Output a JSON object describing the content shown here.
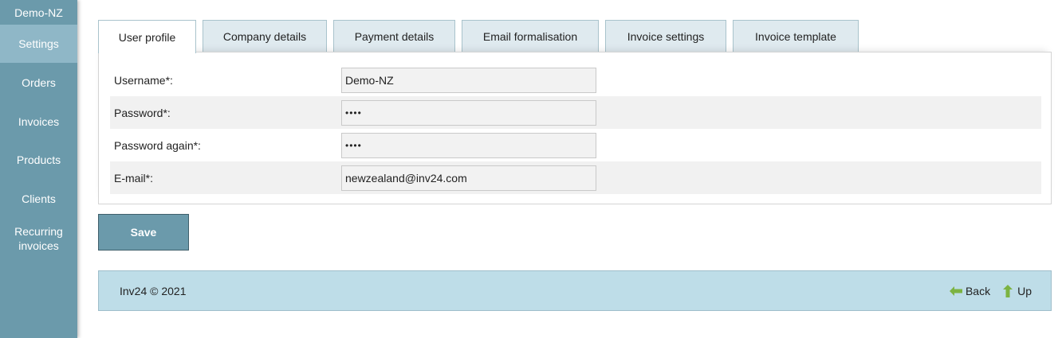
{
  "sidebar": {
    "account": "Demo-NZ",
    "items": [
      {
        "label": "Settings"
      },
      {
        "label": "Orders"
      },
      {
        "label": "Invoices"
      },
      {
        "label": "Products"
      },
      {
        "label": "Clients"
      },
      {
        "label": "Recurring invoices"
      }
    ]
  },
  "tabs": [
    {
      "label": "User profile",
      "active": true
    },
    {
      "label": "Company details"
    },
    {
      "label": "Payment details"
    },
    {
      "label": "Email formalisation"
    },
    {
      "label": "Invoice settings"
    },
    {
      "label": "Invoice template"
    }
  ],
  "form": {
    "username": {
      "label": "Username*:",
      "value": "Demo-NZ"
    },
    "password": {
      "label": "Password*:",
      "value": "••••"
    },
    "password_again": {
      "label": "Password again*:",
      "value": "••••"
    },
    "email": {
      "label": "E-mail*:",
      "value": "newzealand@inv24.com"
    }
  },
  "save_label": "Save",
  "footer": {
    "copyright": "Inv24 © 2021",
    "back_label": "Back",
    "up_label": "Up"
  },
  "colors": {
    "sidebar": "#6b9aab",
    "sidebar_active": "#8fb7c7",
    "footer": "#bedde8",
    "arrow_green": "#7cb342"
  }
}
